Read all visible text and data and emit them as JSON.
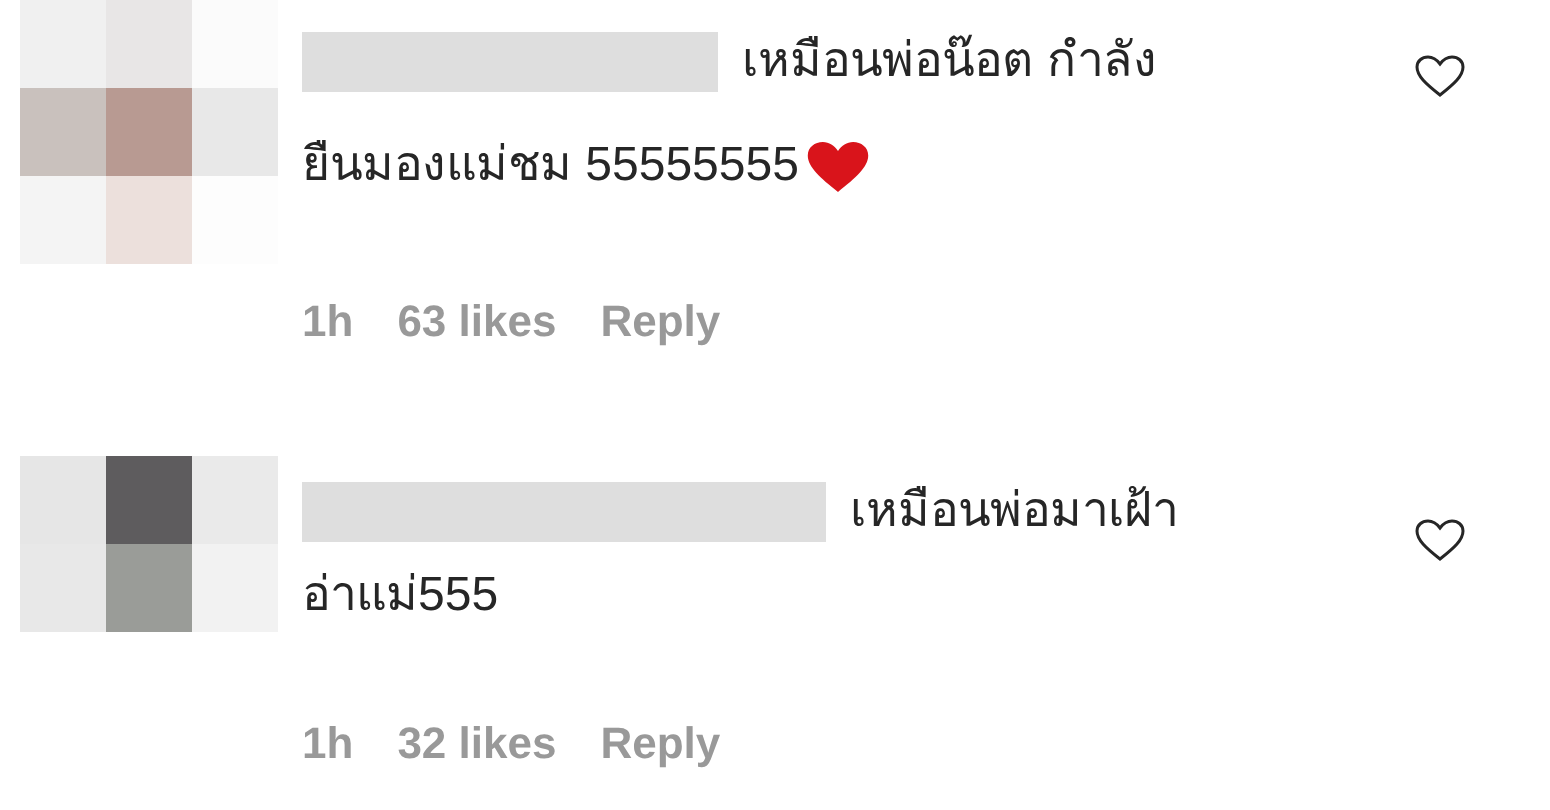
{
  "comments": [
    {
      "text_lines": [
        "เหมือนพ่อน๊อต กำลัง",
        "ยืนมองแม่ชม 55555555"
      ],
      "time": "1h",
      "likes": "63 likes",
      "reply": "Reply",
      "liked": false
    },
    {
      "text_lines": [
        "เหมือนพ่อมาเฝ้า",
        "อ่าแม่555"
      ],
      "time": "1h",
      "likes": "32 likes",
      "reply": "Reply",
      "liked": false
    }
  ]
}
